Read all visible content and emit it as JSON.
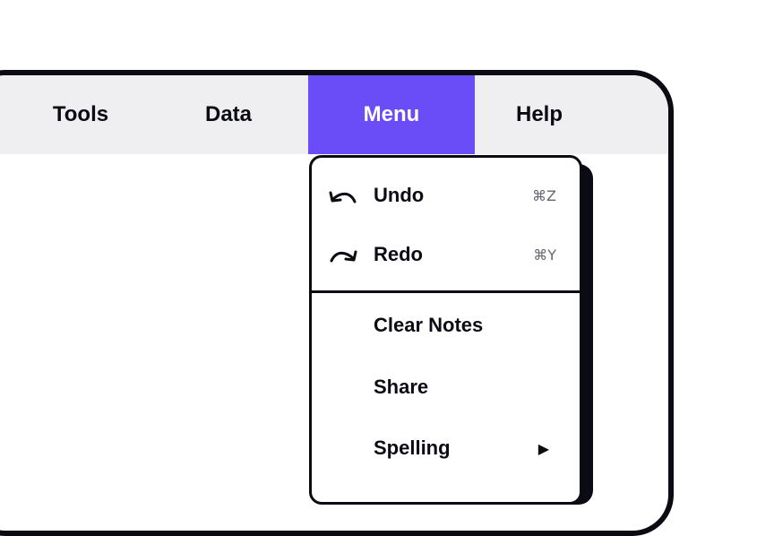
{
  "menubar": {
    "items": [
      {
        "label": "Tools"
      },
      {
        "label": "Data"
      },
      {
        "label": "Menu",
        "active": true
      },
      {
        "label": "Help"
      }
    ],
    "active_color": "#6a4df6"
  },
  "dropdown": {
    "undo": {
      "label": "Undo",
      "shortcut": "⌘Z",
      "icon": "undo-icon"
    },
    "redo": {
      "label": "Redo",
      "shortcut": "⌘Y",
      "icon": "redo-icon"
    },
    "clear_notes": {
      "label": "Clear Notes"
    },
    "share": {
      "label": "Share"
    },
    "spelling": {
      "label": "Spelling",
      "submenu_indicator": "▶"
    }
  }
}
